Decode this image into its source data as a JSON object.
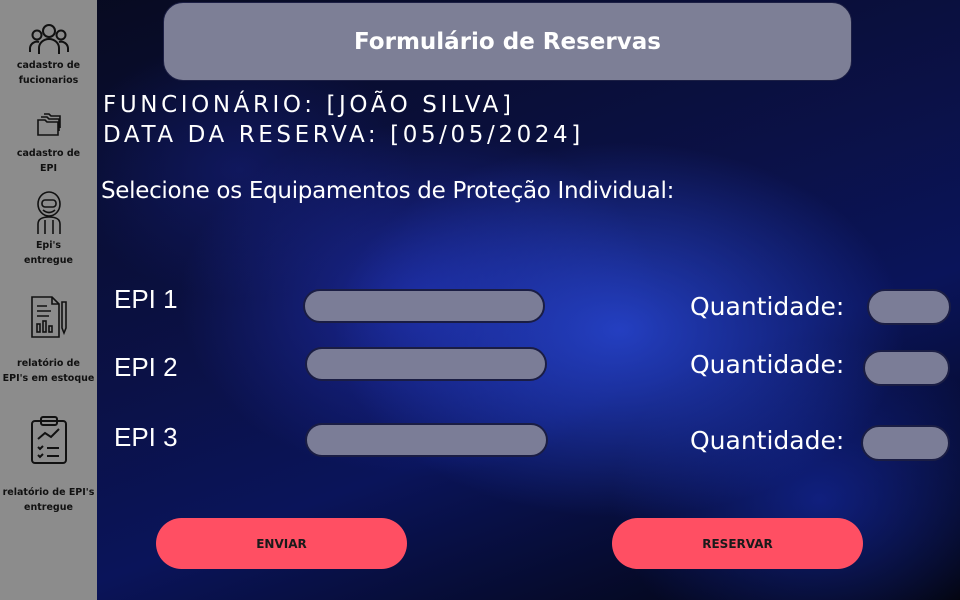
{
  "sidebar": {
    "items": [
      {
        "label_line1": "cadastro de",
        "label_line2": "fucionarios",
        "icon": "users-icon"
      },
      {
        "label_line1": "cadastro de",
        "label_line2": "EPI",
        "icon": "folders-icon"
      },
      {
        "label_line1": "Epi's",
        "label_line2": "entregue",
        "icon": "protective-suit-icon"
      },
      {
        "label_line1": "relatório de",
        "label_line2": "EPI's em estoque",
        "icon": "report-document-icon"
      },
      {
        "label_line1": "relatório de EPI's",
        "label_line2": "entregue",
        "icon": "clipboard-chart-icon"
      }
    ]
  },
  "header": {
    "title": "Formulário de Reservas"
  },
  "info": {
    "employee": "FUNCIONÁRIO: [JOÃO SILVA]",
    "date": "DATA DA RESERVA: [05/05/2024]"
  },
  "instruction": "Selecione os Equipamentos de Proteção Individual:",
  "epi_rows": [
    {
      "label": "EPI 1",
      "value": "",
      "qty_label": "Quantidade:",
      "qty_value": ""
    },
    {
      "label": "EPI 2",
      "value": "",
      "qty_label": "Quantidade:",
      "qty_value": ""
    },
    {
      "label": "EPI 3",
      "value": "",
      "qty_label": "Quantidade:",
      "qty_value": ""
    }
  ],
  "buttons": {
    "send": "ENVIAR",
    "reserve": "RESERVAR"
  },
  "colors": {
    "sidebar": "#8c8c8c",
    "header_box": "#7d7f96",
    "input_fill": "#7b7d97",
    "button": "#ff4f63",
    "background_dark": "#070a1e",
    "background_blue": "#1a2cb0"
  }
}
